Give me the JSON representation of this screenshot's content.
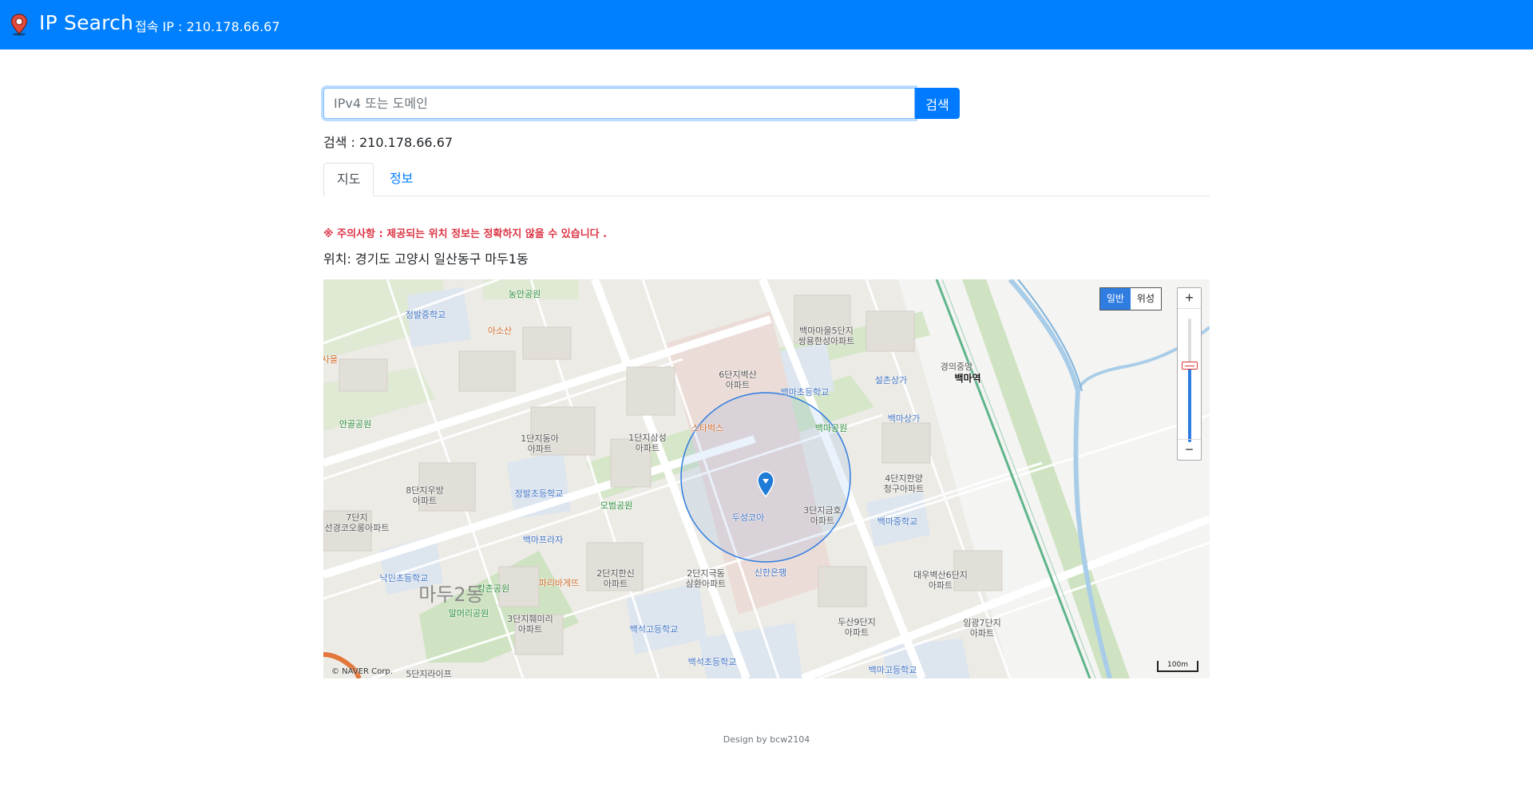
{
  "app": {
    "title": "IP Search",
    "connection_ip": "접속 IP : 210.178.66.67"
  },
  "search": {
    "placeholder": "IPv4 또는 도메인",
    "value": "",
    "button_label": "검색",
    "result": "검색 : 210.178.66.67"
  },
  "tabs": [
    {
      "label": "지도",
      "active": true
    },
    {
      "label": "정보",
      "active": false
    }
  ],
  "notice": "※ 주의사항 : 제공되는 위치 정보는 정확하지 않을 수 있습니다 .",
  "location": "위치: 경기도 고양시 일산동구 마두1동",
  "map": {
    "type_buttons": {
      "normal": "일반",
      "satellite": "위성"
    },
    "zoom_level_fraction": 0.62,
    "copyright": "© NAVER Corp.",
    "scale": "100m",
    "labels": [
      {
        "text": "농안공원",
        "kind": "park"
      },
      {
        "text": "정발중학교",
        "kind": "school"
      },
      {
        "text": "아소산",
        "kind": "food"
      },
      {
        "text": "백마마을5단지\n쌍용한성아파트",
        "kind": "apt"
      },
      {
        "text": "경의중앙",
        "kind": "apt"
      },
      {
        "text": "백마역",
        "kind": "station"
      },
      {
        "text": "6단지벽산\n아파트",
        "kind": "apt"
      },
      {
        "text": "백마초등학교",
        "kind": "school"
      },
      {
        "text": "설촌상가",
        "kind": "school"
      },
      {
        "text": "안골공원",
        "kind": "park"
      },
      {
        "text": "1단지동아\n아파트",
        "kind": "apt"
      },
      {
        "text": "1단지삼성\n아파트",
        "kind": "apt"
      },
      {
        "text": "스타벅스",
        "kind": "food"
      },
      {
        "text": "백마공원",
        "kind": "park"
      },
      {
        "text": "백마상가",
        "kind": "school"
      },
      {
        "text": "8단지우방\n아파트",
        "kind": "apt"
      },
      {
        "text": "정발초등학교",
        "kind": "school"
      },
      {
        "text": "모범공원",
        "kind": "park"
      },
      {
        "text": "4단지한양\n청구아파트",
        "kind": "apt"
      },
      {
        "text": "7단지\n선경코오롱아파트",
        "kind": "apt"
      },
      {
        "text": "두성코아",
        "kind": "school"
      },
      {
        "text": "3단지금호\n아파트",
        "kind": "apt"
      },
      {
        "text": "백마중학교",
        "kind": "school"
      },
      {
        "text": "백마프라자",
        "kind": "school"
      },
      {
        "text": "낙민초등학교",
        "kind": "school"
      },
      {
        "text": "파리바게뜨",
        "kind": "food"
      },
      {
        "text": "2단지한신\n아파트",
        "kind": "apt"
      },
      {
        "text": "2단지극동\n삼환아파트",
        "kind": "apt"
      },
      {
        "text": "신한은행",
        "kind": "school"
      },
      {
        "text": "대우벽산6단지\n아파트",
        "kind": "apt"
      },
      {
        "text": "강촌공원",
        "kind": "park"
      },
      {
        "text": "마두2동",
        "kind": "big"
      },
      {
        "text": "말머리공원",
        "kind": "park"
      },
      {
        "text": "3단지훼미리\n아파트",
        "kind": "apt"
      },
      {
        "text": "백석고등학교",
        "kind": "school"
      },
      {
        "text": "두산9단지\n아파트",
        "kind": "apt"
      },
      {
        "text": "임광7단지\n아파트",
        "kind": "apt"
      },
      {
        "text": "5단지라이프",
        "kind": "apt"
      },
      {
        "text": "백석초등학교",
        "kind": "school"
      },
      {
        "text": "백마고등학교",
        "kind": "school"
      },
      {
        "text": "사을",
        "kind": "food"
      }
    ]
  },
  "footer": "Design by bcw2104",
  "colors": {
    "navbar": "#0080ff",
    "primary": "#007bff",
    "danger": "#dc3545"
  }
}
